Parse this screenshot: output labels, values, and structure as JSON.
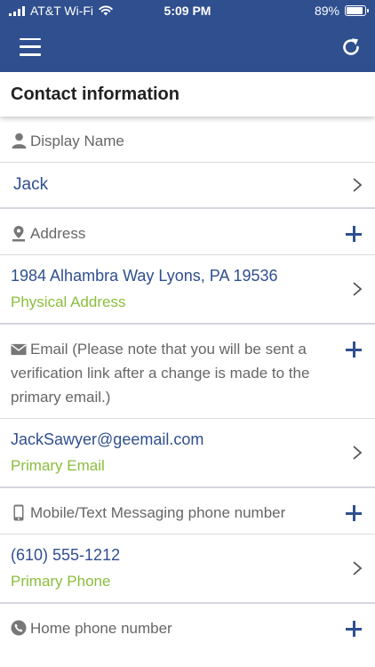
{
  "status_bar": {
    "carrier": "AT&T Wi-Fi",
    "time": "5:09 PM",
    "battery": "89%",
    "battery_level": 0.89
  },
  "navbar": {
    "menu_icon": "hamburger-menu-icon",
    "refresh_icon": "refresh-icon"
  },
  "page": {
    "title": "Contact information"
  },
  "sections": {
    "display_name": {
      "label": "Display Name",
      "value": "Jack"
    },
    "address": {
      "label": "Address",
      "value": "1984 Alhambra Way Lyons, PA 19536",
      "type": "Physical Address"
    },
    "email": {
      "label": "Email (Please note that you will be sent a verification link after a change is made to the primary email.)",
      "value": "JackSawyer@geemail.com",
      "type": "Primary Email"
    },
    "mobile": {
      "label": "Mobile/Text Messaging phone number",
      "value": "(610) 555-1212",
      "type": "Primary Phone"
    },
    "home_phone": {
      "label": "Home phone number"
    }
  },
  "colors": {
    "brand": "#2f4f8f",
    "accent_green": "#8bbd3c"
  }
}
